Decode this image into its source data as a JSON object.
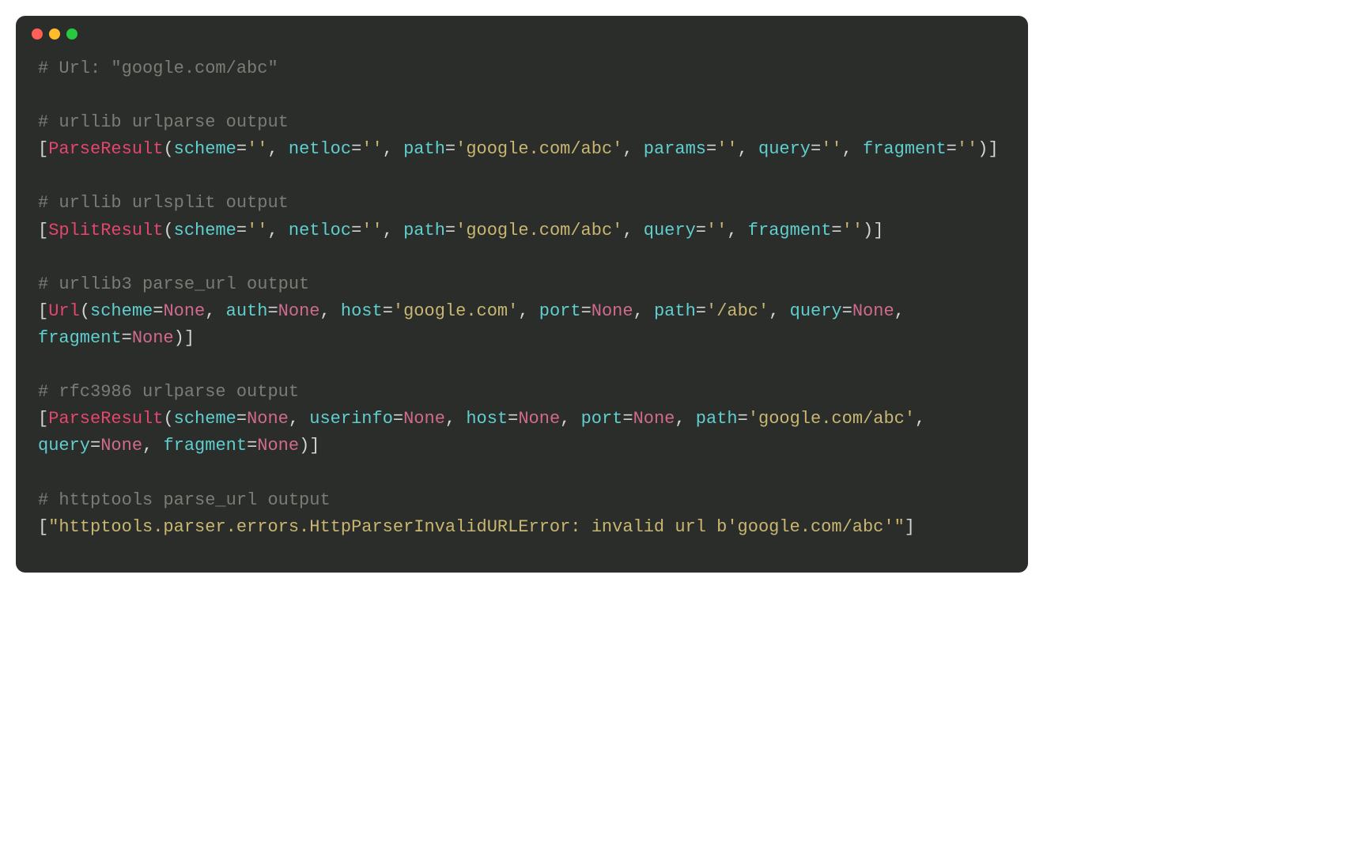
{
  "titlebar": {
    "dots": [
      "red",
      "yellow",
      "green"
    ]
  },
  "comments": {
    "url": "# Url: \"google.com/abc\"",
    "urlparse": "# urllib urlparse output",
    "urlsplit": "# urllib urlsplit output",
    "urllib3": "# urllib3 parse_url output",
    "rfc3986": "# rfc3986 urlparse output",
    "httptools": "# httptools parse_url output"
  },
  "tokens": {
    "lbracket": "[",
    "rbracket": "]",
    "lparen": "(",
    "rparen": ")",
    "comma": ", ",
    "eq": "=",
    "empty": "''",
    "none": "None",
    "parseresult": "ParseResult",
    "splitresult": "SplitResult",
    "urlclass": "Url",
    "scheme": "scheme",
    "netloc": "netloc",
    "path": "path",
    "params": "params",
    "query": "query",
    "fragment": "fragment",
    "auth": "auth",
    "host": "host",
    "port": "port",
    "userinfo": "userinfo",
    "googleabc": "'google.com/abc'",
    "googlehost": "'google.com'",
    "slashabc": "'/abc'",
    "httperror": "\"httptools.parser.errors.HttpParserInvalidURLError: invalid url b'google.com/abc'\""
  }
}
